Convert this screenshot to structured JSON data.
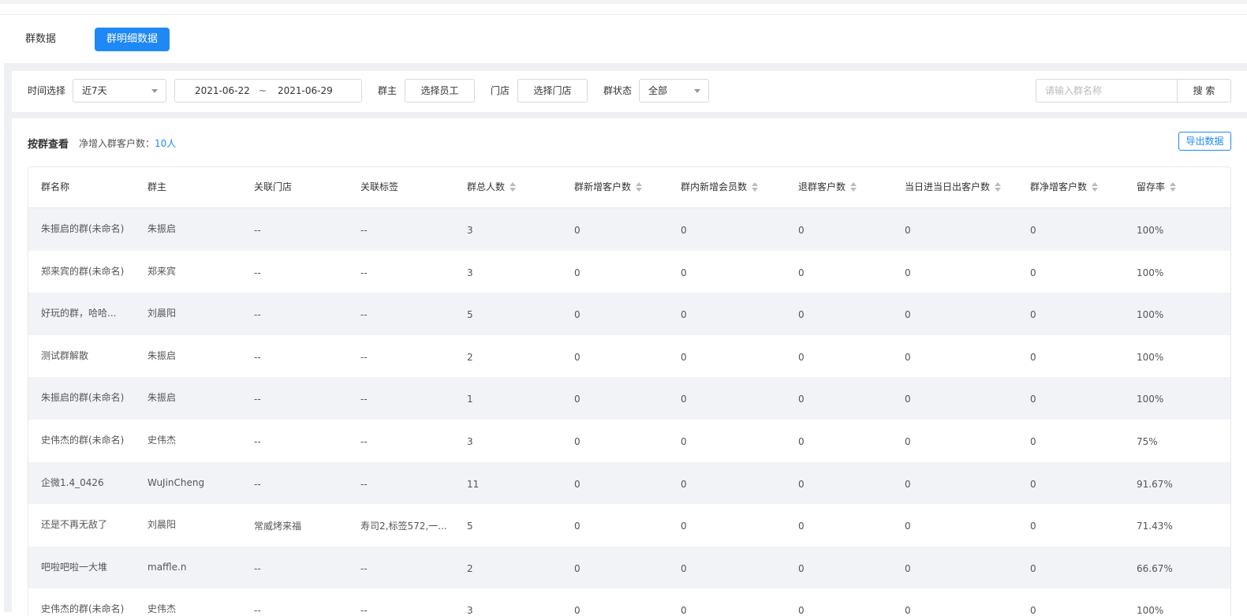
{
  "tabs": [
    {
      "label": "群数据",
      "active": false
    },
    {
      "label": "群明细数据",
      "active": true
    }
  ],
  "filters": {
    "time_label": "时间选择",
    "time_value": "近7天",
    "date_start": "2021-06-22",
    "date_sep": "~",
    "date_end": "2021-06-29",
    "owner_label": "群主",
    "owner_button": "选择员工",
    "store_label": "门店",
    "store_button": "选择门店",
    "status_label": "群状态",
    "status_value": "全部",
    "search_placeholder": "请输入群名称",
    "search_button": "搜 索"
  },
  "summary": {
    "title": "按群查看",
    "net_label": "净增入群客户数：",
    "net_value": "10人",
    "export_button": "导出数据"
  },
  "table": {
    "columns": [
      "群名称",
      "群主",
      "关联门店",
      "关联标签",
      "群总人数",
      "群新增客户数",
      "群内新增会员数",
      "退群客户数",
      "当日进当日出客户数",
      "群净增客户数",
      "留存率"
    ],
    "rows": [
      [
        "朱振启的群(未命名)",
        "朱振启",
        "--",
        "--",
        "3",
        "0",
        "0",
        "0",
        "0",
        "0",
        "100%"
      ],
      [
        "郑来宾的群(未命名)",
        "郑来宾",
        "--",
        "--",
        "3",
        "0",
        "0",
        "0",
        "0",
        "0",
        "100%"
      ],
      [
        "好玩的群，哈哈...",
        "刘晨阳",
        "--",
        "--",
        "5",
        "0",
        "0",
        "0",
        "0",
        "0",
        "100%"
      ],
      [
        "测试群解散",
        "朱振启",
        "--",
        "--",
        "2",
        "0",
        "0",
        "0",
        "0",
        "0",
        "100%"
      ],
      [
        "朱振启的群(未命名)",
        "朱振启",
        "--",
        "--",
        "1",
        "0",
        "0",
        "0",
        "0",
        "0",
        "100%"
      ],
      [
        "史伟杰的群(未命名)",
        "史伟杰",
        "--",
        "--",
        "3",
        "0",
        "0",
        "0",
        "0",
        "0",
        "75%"
      ],
      [
        "企微1.4_0426",
        "WuJinCheng",
        "--",
        "--",
        "11",
        "0",
        "0",
        "0",
        "0",
        "0",
        "91.67%"
      ],
      [
        "还是不再无敌了",
        "刘晨阳",
        "常威烤来福",
        "寿司2,标签572,一...",
        "5",
        "0",
        "0",
        "0",
        "0",
        "0",
        "71.43%"
      ],
      [
        "吧啦吧啦一大堆",
        "maffle.n",
        "--",
        "--",
        "2",
        "0",
        "0",
        "0",
        "0",
        "0",
        "66.67%"
      ],
      [
        "史伟杰的群(未命名)",
        "史伟杰",
        "--",
        "--",
        "3",
        "0",
        "0",
        "0",
        "0",
        "0",
        "100%"
      ]
    ]
  }
}
